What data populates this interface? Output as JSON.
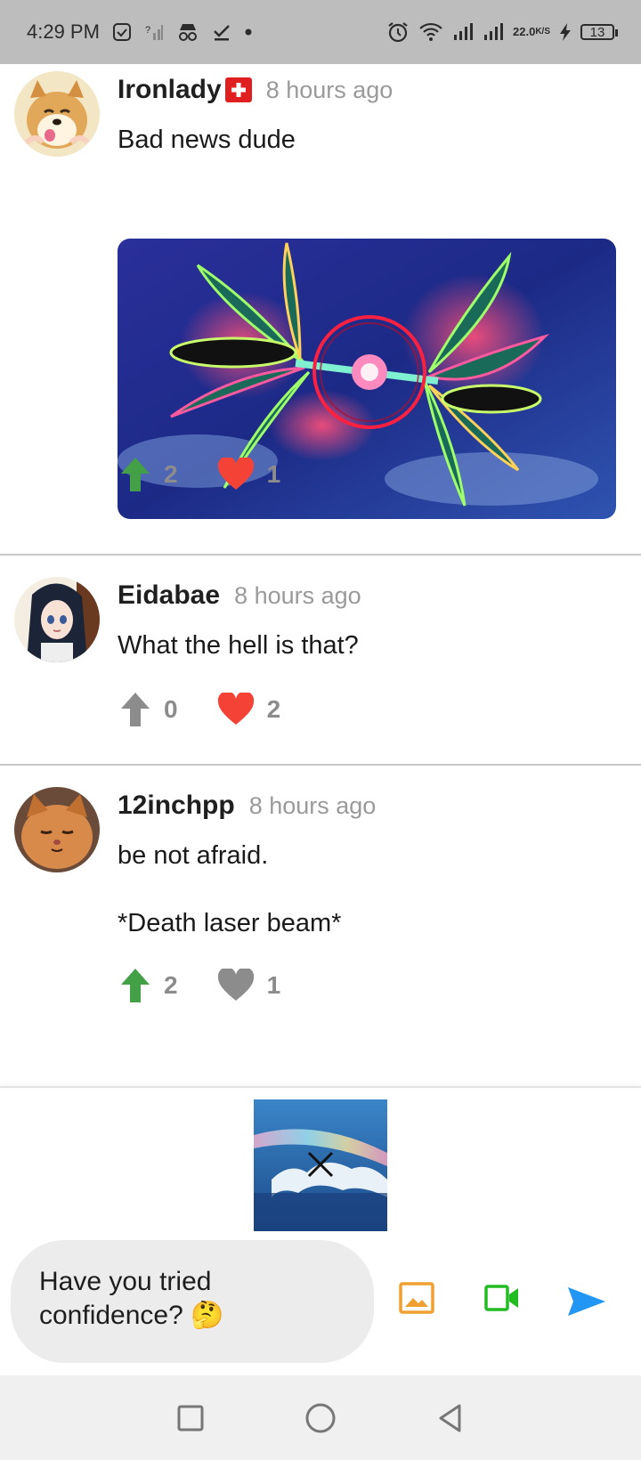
{
  "status_bar": {
    "time": "4:29 PM",
    "net_speed_value": "22.0",
    "net_speed_unit": "K/S",
    "battery": "13"
  },
  "comments": [
    {
      "username": "Ironlady",
      "flag": "🇨🇭",
      "time": "8 hours ago",
      "text": "Bad news dude",
      "upvotes": "2",
      "likes": "1",
      "upvoted": true,
      "liked": true,
      "has_image": true
    },
    {
      "username": "Eidabae",
      "time": "8 hours ago",
      "text": "What the hell is that?",
      "upvotes": "0",
      "likes": "2",
      "upvoted": false,
      "liked": true
    },
    {
      "username": "12inchpp",
      "time": "8 hours ago",
      "text": "be not afraid.\n\n*Death laser beam*",
      "upvotes": "2",
      "likes": "1",
      "upvoted": true,
      "liked": false
    }
  ],
  "composer": {
    "input_value": "Have you tried confidence? 🤔",
    "tools": [
      "image-icon",
      "video-icon",
      "send-icon"
    ]
  },
  "colors": {
    "upvote_active": "#43a047",
    "upvote_inactive": "#8c8c8c",
    "heart_active": "#f44336",
    "heart_inactive": "#8c8c8c",
    "image_tool": "#f0a030",
    "video_tool": "#22bb22",
    "send_tool": "#2196f3"
  }
}
